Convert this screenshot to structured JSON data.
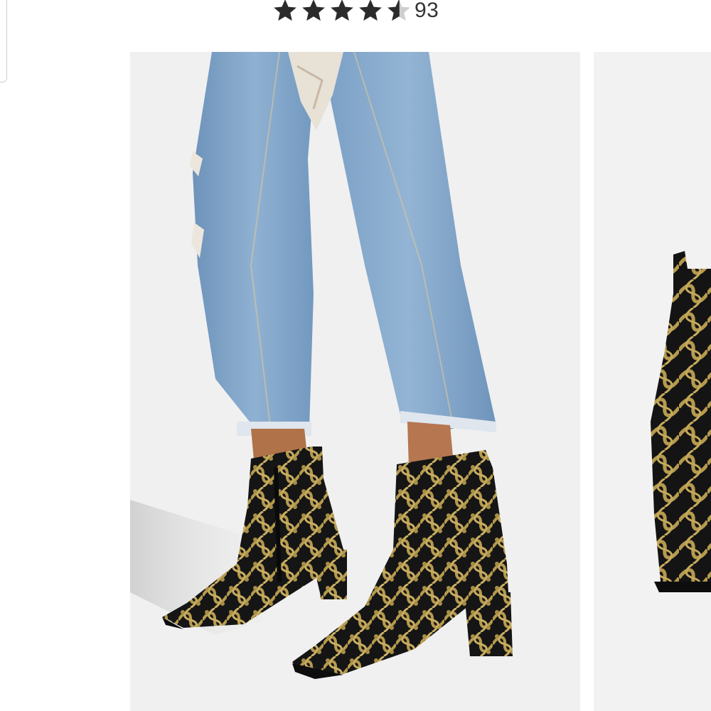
{
  "product": {
    "rating_value": 4.5,
    "rating_max": 5,
    "review_count": "93"
  },
  "gallery": {
    "slides": [
      {
        "kind": "product-photo-on-model"
      },
      {
        "kind": "product-photo-side"
      }
    ],
    "current_index": 0
  },
  "colors": {
    "star_fill": "#2b2b2b",
    "star_empty": "#cfcfcf",
    "photo_bg": "#f0f0f0",
    "denim": "#7fa3c8",
    "boot_black": "#1a1a1a",
    "boot_gold": "#b59a4e"
  }
}
